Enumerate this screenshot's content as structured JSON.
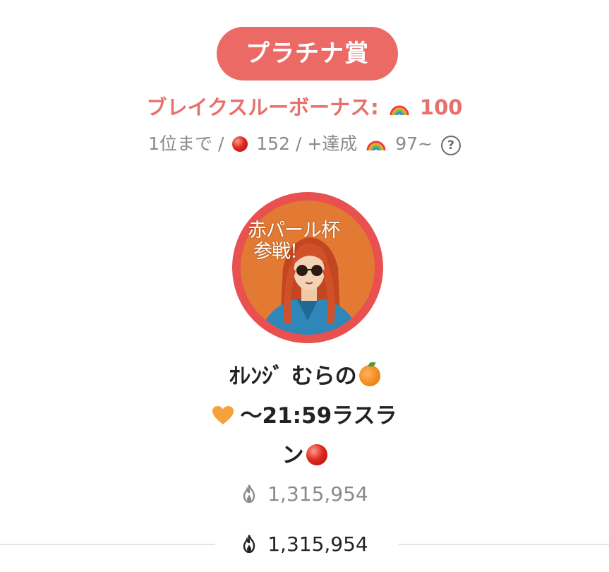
{
  "award": {
    "label": "プラチナ賞"
  },
  "bonus": {
    "label": "ブレイクスルーボーナス:",
    "icon": "rainbow-icon",
    "value": "100"
  },
  "rank": {
    "prefix": "1位まで /",
    "points_icon": "red-circle-icon",
    "points": "152",
    "middle": "/ +達成",
    "bonus_icon": "rainbow-icon",
    "bonus_points": "97~",
    "help_icon": "question-circle-icon",
    "help_glyph": "?"
  },
  "avatar": {
    "caption_line1": "赤パール杯",
    "caption_line2": "参戦!",
    "ring_color": "#e8514f"
  },
  "user": {
    "name_line1": "ｵﾚﾝｼﾞ むらの",
    "name_line2": "～21:59ラスラ",
    "name_line3": "ン",
    "icons": [
      "orange-icon",
      "orange-heart-icon",
      "red-circle-icon"
    ]
  },
  "scores": {
    "total": "1,315,954",
    "current": "1,315,954",
    "icon": "flame-icon"
  },
  "colors": {
    "accent": "#ec6a66",
    "bonus_text": "#e8706c",
    "muted_text": "#8a8a8a",
    "primary_text": "#222222"
  }
}
